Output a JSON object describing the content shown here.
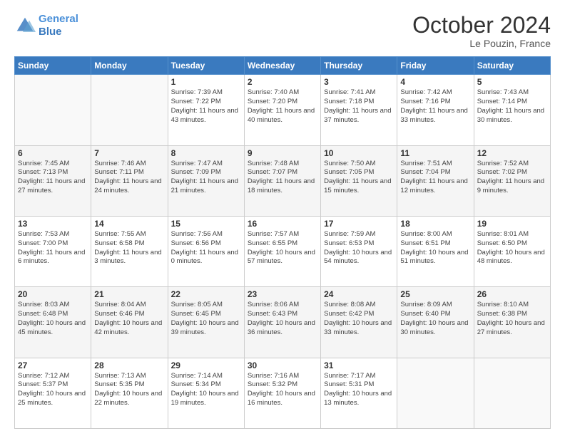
{
  "header": {
    "logo_line1": "General",
    "logo_line2": "Blue",
    "month": "October 2024",
    "location": "Le Pouzin, France"
  },
  "weekdays": [
    "Sunday",
    "Monday",
    "Tuesday",
    "Wednesday",
    "Thursday",
    "Friday",
    "Saturday"
  ],
  "weeks": [
    [
      {
        "day": "",
        "info": ""
      },
      {
        "day": "",
        "info": ""
      },
      {
        "day": "1",
        "info": "Sunrise: 7:39 AM\nSunset: 7:22 PM\nDaylight: 11 hours and 43 minutes."
      },
      {
        "day": "2",
        "info": "Sunrise: 7:40 AM\nSunset: 7:20 PM\nDaylight: 11 hours and 40 minutes."
      },
      {
        "day": "3",
        "info": "Sunrise: 7:41 AM\nSunset: 7:18 PM\nDaylight: 11 hours and 37 minutes."
      },
      {
        "day": "4",
        "info": "Sunrise: 7:42 AM\nSunset: 7:16 PM\nDaylight: 11 hours and 33 minutes."
      },
      {
        "day": "5",
        "info": "Sunrise: 7:43 AM\nSunset: 7:14 PM\nDaylight: 11 hours and 30 minutes."
      }
    ],
    [
      {
        "day": "6",
        "info": "Sunrise: 7:45 AM\nSunset: 7:13 PM\nDaylight: 11 hours and 27 minutes."
      },
      {
        "day": "7",
        "info": "Sunrise: 7:46 AM\nSunset: 7:11 PM\nDaylight: 11 hours and 24 minutes."
      },
      {
        "day": "8",
        "info": "Sunrise: 7:47 AM\nSunset: 7:09 PM\nDaylight: 11 hours and 21 minutes."
      },
      {
        "day": "9",
        "info": "Sunrise: 7:48 AM\nSunset: 7:07 PM\nDaylight: 11 hours and 18 minutes."
      },
      {
        "day": "10",
        "info": "Sunrise: 7:50 AM\nSunset: 7:05 PM\nDaylight: 11 hours and 15 minutes."
      },
      {
        "day": "11",
        "info": "Sunrise: 7:51 AM\nSunset: 7:04 PM\nDaylight: 11 hours and 12 minutes."
      },
      {
        "day": "12",
        "info": "Sunrise: 7:52 AM\nSunset: 7:02 PM\nDaylight: 11 hours and 9 minutes."
      }
    ],
    [
      {
        "day": "13",
        "info": "Sunrise: 7:53 AM\nSunset: 7:00 PM\nDaylight: 11 hours and 6 minutes."
      },
      {
        "day": "14",
        "info": "Sunrise: 7:55 AM\nSunset: 6:58 PM\nDaylight: 11 hours and 3 minutes."
      },
      {
        "day": "15",
        "info": "Sunrise: 7:56 AM\nSunset: 6:56 PM\nDaylight: 11 hours and 0 minutes."
      },
      {
        "day": "16",
        "info": "Sunrise: 7:57 AM\nSunset: 6:55 PM\nDaylight: 10 hours and 57 minutes."
      },
      {
        "day": "17",
        "info": "Sunrise: 7:59 AM\nSunset: 6:53 PM\nDaylight: 10 hours and 54 minutes."
      },
      {
        "day": "18",
        "info": "Sunrise: 8:00 AM\nSunset: 6:51 PM\nDaylight: 10 hours and 51 minutes."
      },
      {
        "day": "19",
        "info": "Sunrise: 8:01 AM\nSunset: 6:50 PM\nDaylight: 10 hours and 48 minutes."
      }
    ],
    [
      {
        "day": "20",
        "info": "Sunrise: 8:03 AM\nSunset: 6:48 PM\nDaylight: 10 hours and 45 minutes."
      },
      {
        "day": "21",
        "info": "Sunrise: 8:04 AM\nSunset: 6:46 PM\nDaylight: 10 hours and 42 minutes."
      },
      {
        "day": "22",
        "info": "Sunrise: 8:05 AM\nSunset: 6:45 PM\nDaylight: 10 hours and 39 minutes."
      },
      {
        "day": "23",
        "info": "Sunrise: 8:06 AM\nSunset: 6:43 PM\nDaylight: 10 hours and 36 minutes."
      },
      {
        "day": "24",
        "info": "Sunrise: 8:08 AM\nSunset: 6:42 PM\nDaylight: 10 hours and 33 minutes."
      },
      {
        "day": "25",
        "info": "Sunrise: 8:09 AM\nSunset: 6:40 PM\nDaylight: 10 hours and 30 minutes."
      },
      {
        "day": "26",
        "info": "Sunrise: 8:10 AM\nSunset: 6:38 PM\nDaylight: 10 hours and 27 minutes."
      }
    ],
    [
      {
        "day": "27",
        "info": "Sunrise: 7:12 AM\nSunset: 5:37 PM\nDaylight: 10 hours and 25 minutes."
      },
      {
        "day": "28",
        "info": "Sunrise: 7:13 AM\nSunset: 5:35 PM\nDaylight: 10 hours and 22 minutes."
      },
      {
        "day": "29",
        "info": "Sunrise: 7:14 AM\nSunset: 5:34 PM\nDaylight: 10 hours and 19 minutes."
      },
      {
        "day": "30",
        "info": "Sunrise: 7:16 AM\nSunset: 5:32 PM\nDaylight: 10 hours and 16 minutes."
      },
      {
        "day": "31",
        "info": "Sunrise: 7:17 AM\nSunset: 5:31 PM\nDaylight: 10 hours and 13 minutes."
      },
      {
        "day": "",
        "info": ""
      },
      {
        "day": "",
        "info": ""
      }
    ]
  ]
}
